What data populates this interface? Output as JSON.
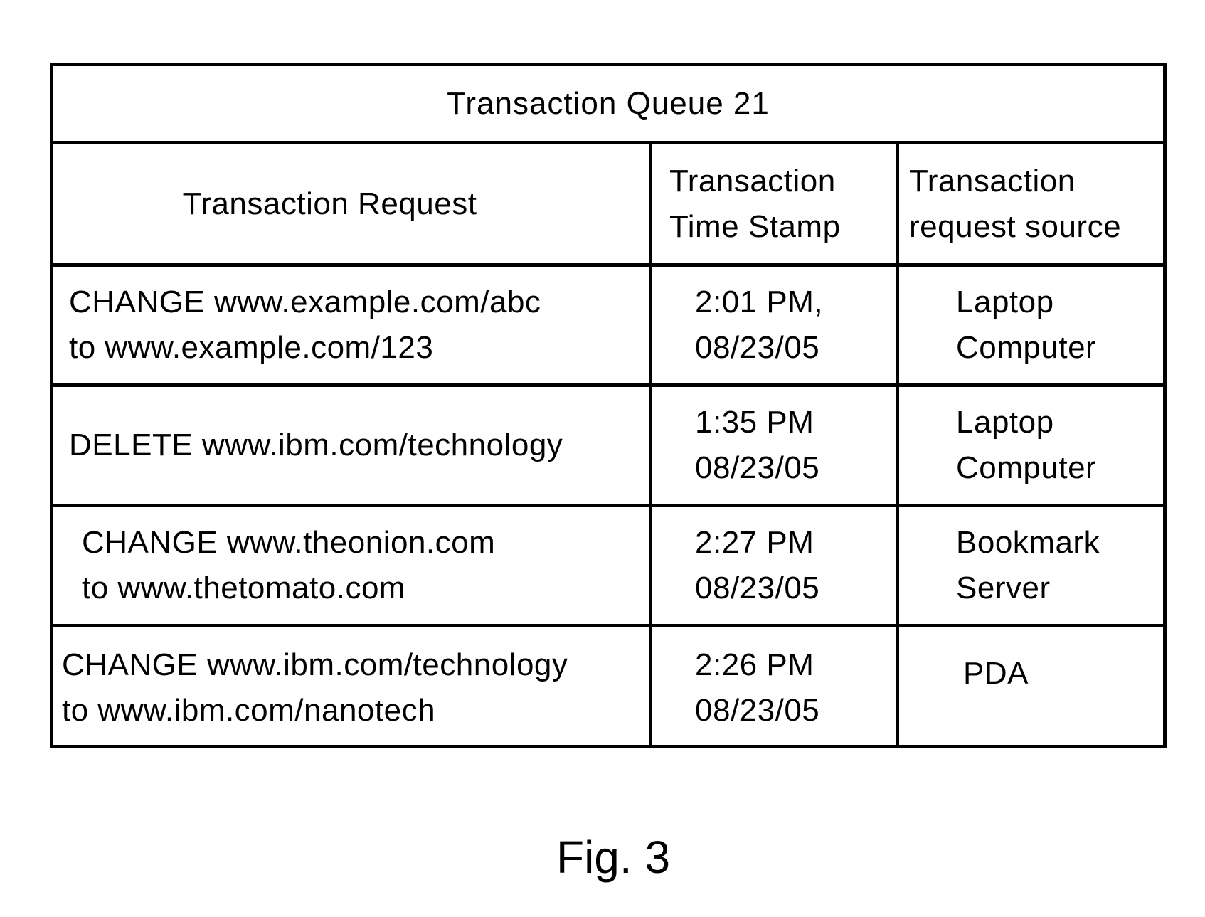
{
  "figure": {
    "caption": "Fig. 3"
  },
  "table": {
    "title": "Transaction Queue  21",
    "headers": {
      "request": "Transaction Request",
      "timestamp": [
        "Transaction",
        "Time Stamp"
      ],
      "source": [
        "Transaction",
        "request source"
      ]
    },
    "rows": [
      {
        "request": [
          "CHANGE www.example.com/abc",
          "to www.example.com/123"
        ],
        "timestamp": [
          "2:01 PM,",
          "08/23/05"
        ],
        "source": [
          "Laptop",
          "Computer"
        ]
      },
      {
        "request": [
          "DELETE www.ibm.com/technology"
        ],
        "timestamp": [
          "1:35 PM",
          "08/23/05"
        ],
        "source": [
          "Laptop",
          "Computer"
        ]
      },
      {
        "request": [
          "CHANGE www.theonion.com",
          "to www.thetomato.com"
        ],
        "timestamp": [
          "2:27 PM",
          "08/23/05"
        ],
        "source": [
          "Bookmark",
          "Server"
        ]
      },
      {
        "request": [
          "CHANGE www.ibm.com/technology",
          "to www.ibm.com/nanotech"
        ],
        "timestamp": [
          "2:26 PM",
          "08/23/05"
        ],
        "source": [
          "PDA"
        ]
      }
    ]
  }
}
